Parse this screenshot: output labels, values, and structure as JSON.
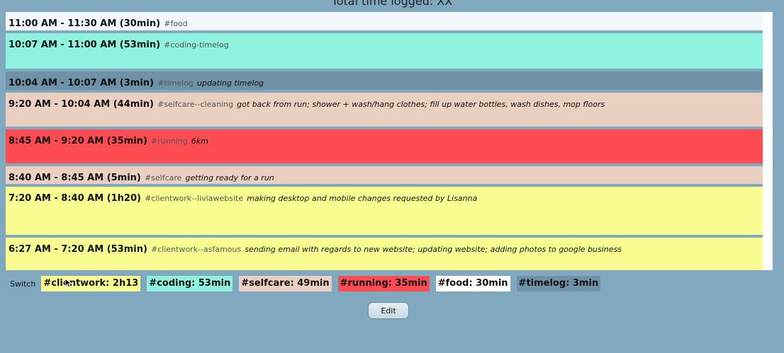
{
  "header": {
    "title": "Total time logged: XX"
  },
  "entries": [
    {
      "time": "11:00 AM - 11:30 AM (30min)",
      "tag": "#food",
      "note": "",
      "color": "#f3f6fa",
      "height": 26
    },
    {
      "time": "10:07 AM - 11:00 AM (53min)",
      "tag": "#coding-timelog",
      "note": "",
      "color": "#8ff2de",
      "height": 50
    },
    {
      "time": "10:04 AM - 10:07 AM (3min)",
      "tag": "#timelog",
      "note": "updating timelog",
      "color": "#6f92a6",
      "height": 26
    },
    {
      "time": "9:20 AM - 10:04 AM (44min)",
      "tag": "#selfcare--cleaning",
      "note": "got back from run; shower + wash/hang clothes; fill up water bottles, wash dishes, mop floors",
      "color": "#ead0c0",
      "height": 48
    },
    {
      "time": "8:45 AM - 9:20 AM (35min)",
      "tag": "#running",
      "note": "6km",
      "color": "#ff4b52",
      "height": 48
    },
    {
      "time": "8:40 AM - 8:45 AM (5min)",
      "tag": "#selfcare",
      "note": "getting ready for a run",
      "color": "#ead0c0",
      "height": 25
    },
    {
      "time": "7:20 AM - 8:40 AM (1h20)",
      "tag": "#clientwork--liviawebsite",
      "note": "making desktop and mobile changes requested by Lisanna",
      "color": "#fafe91",
      "height": 68
    },
    {
      "time": "6:27 AM - 7:20 AM (53min)",
      "tag": "#clientwork--asfamous",
      "note": "sending email with regards to new website; updating website; adding photos to google business",
      "color": "#fafe91",
      "height": 50
    }
  ],
  "switch": {
    "label": "Switch",
    "summaries": [
      {
        "text": "#clientwork: 2h13",
        "color": "#fafe91"
      },
      {
        "text": "#coding: 53min",
        "color": "#8ff2de"
      },
      {
        "text": "#selfcare: 49min",
        "color": "#ead0c0"
      },
      {
        "text": "#running: 35min",
        "color": "#ff4b52"
      },
      {
        "text": "#food: 30min",
        "color": "#ffffff"
      },
      {
        "text": "#timelog: 3min",
        "color": "#6f92a6"
      }
    ]
  },
  "edit_label": "Edit"
}
